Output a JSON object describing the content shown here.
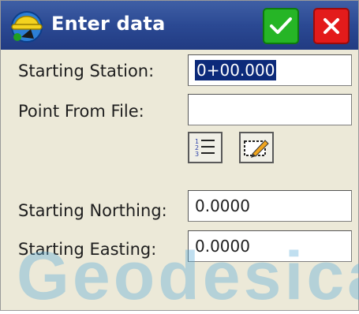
{
  "dialog": {
    "title": "Enter data",
    "ok_icon": "checkmark-icon",
    "cancel_icon": "close-icon"
  },
  "form": {
    "starting_station": {
      "label": "Starting Station:",
      "value": "0+00.000"
    },
    "point_from_file": {
      "label": "Point From File:",
      "value": ""
    },
    "list_button_icon": "numbered-list-icon",
    "map_button_icon": "map-pencil-icon",
    "starting_northing": {
      "label": "Starting Northing:",
      "value": "0.0000"
    },
    "starting_easting": {
      "label": "Starting Easting:",
      "value": "0.0000"
    }
  },
  "watermark": {
    "text": "Geodesica"
  },
  "colors": {
    "titlebar": "#2b4993",
    "ok_button": "#26b526",
    "cancel_button": "#e31b1b",
    "selection": "#0c2a7a",
    "background": "#ece9d8"
  }
}
